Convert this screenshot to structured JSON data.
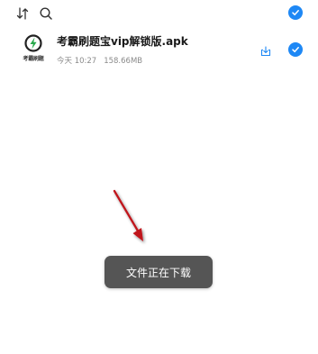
{
  "toolbar": {
    "sort_icon": "sort-icon",
    "search_icon": "search-icon",
    "select_all_checked": true
  },
  "file": {
    "name": "考霸刷题宝vip解锁版.apk",
    "date": "今天 10:27",
    "size": "158.66MB",
    "icon_brand": "考霸刷题",
    "checked": true
  },
  "toast": {
    "message": "文件正在下载"
  },
  "colors": {
    "accent": "#1e88f5",
    "toast_bg": "#555555",
    "arrow": "#c0141b",
    "logo_green": "#27a84a"
  }
}
